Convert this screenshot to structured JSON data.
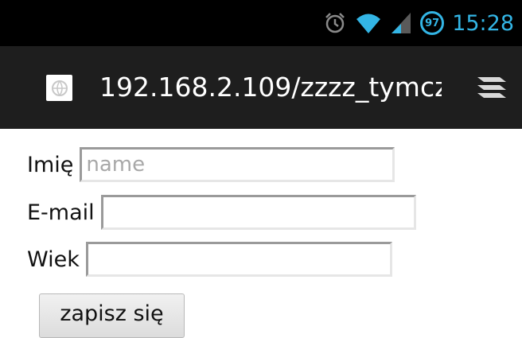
{
  "status_bar": {
    "time": "15:28",
    "battery_level": "97",
    "icons": [
      "alarm-icon",
      "wifi-icon",
      "signal-icon",
      "battery-icon"
    ],
    "accent_color": "#33b5e5"
  },
  "browser": {
    "url": "192.168.2.109/zzzz_tymcz",
    "favicon": "globe-icon",
    "menu_icon": "tabs-menu-icon"
  },
  "form": {
    "name_label": "Imię",
    "name_placeholder": "name",
    "name_value": "",
    "email_label": "E-mail",
    "email_value": "",
    "age_label": "Wiek",
    "age_value": "",
    "submit_label": "zapisz się"
  }
}
